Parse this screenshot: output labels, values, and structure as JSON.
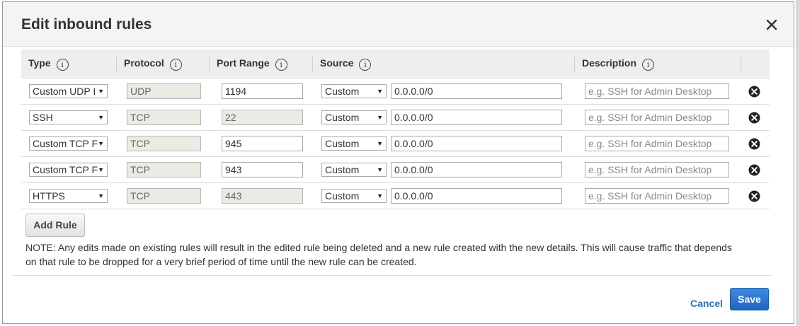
{
  "dialog": {
    "title": "Edit inbound rules",
    "close_icon": "close-icon"
  },
  "table": {
    "headers": {
      "type": "Type",
      "protocol": "Protocol",
      "port_range": "Port Range",
      "source": "Source",
      "description": "Description"
    },
    "info_glyph": "i",
    "rows": [
      {
        "type": "Custom UDP I",
        "protocol": "UDP",
        "port": "1194",
        "port_readonly": false,
        "source_type": "Custom",
        "source": "0.0.0.0/0",
        "description_placeholder": "e.g. SSH for Admin Desktop"
      },
      {
        "type": "SSH",
        "protocol": "TCP",
        "port": "22",
        "port_readonly": true,
        "source_type": "Custom",
        "source": "0.0.0.0/0",
        "description_placeholder": "e.g. SSH for Admin Desktop"
      },
      {
        "type": "Custom TCP F",
        "protocol": "TCP",
        "port": "945",
        "port_readonly": false,
        "source_type": "Custom",
        "source": "0.0.0.0/0",
        "description_placeholder": "e.g. SSH for Admin Desktop"
      },
      {
        "type": "Custom TCP F",
        "protocol": "TCP",
        "port": "943",
        "port_readonly": false,
        "source_type": "Custom",
        "source": "0.0.0.0/0",
        "description_placeholder": "e.g. SSH for Admin Desktop"
      },
      {
        "type": "HTTPS",
        "protocol": "TCP",
        "port": "443",
        "port_readonly": true,
        "source_type": "Custom",
        "source": "0.0.0.0/0",
        "description_placeholder": "e.g. SSH for Admin Desktop"
      }
    ]
  },
  "actions": {
    "add_rule": "Add Rule",
    "cancel": "Cancel",
    "save": "Save"
  },
  "note": "NOTE: Any edits made on existing rules will result in the edited rule being deleted and a new rule created with the new details. This will cause traffic that depends on that rule to be dropped for a very brief period of time until the new rule can be created.",
  "colors": {
    "accent": "#2b73b7",
    "save_button": "#1f65c0"
  }
}
